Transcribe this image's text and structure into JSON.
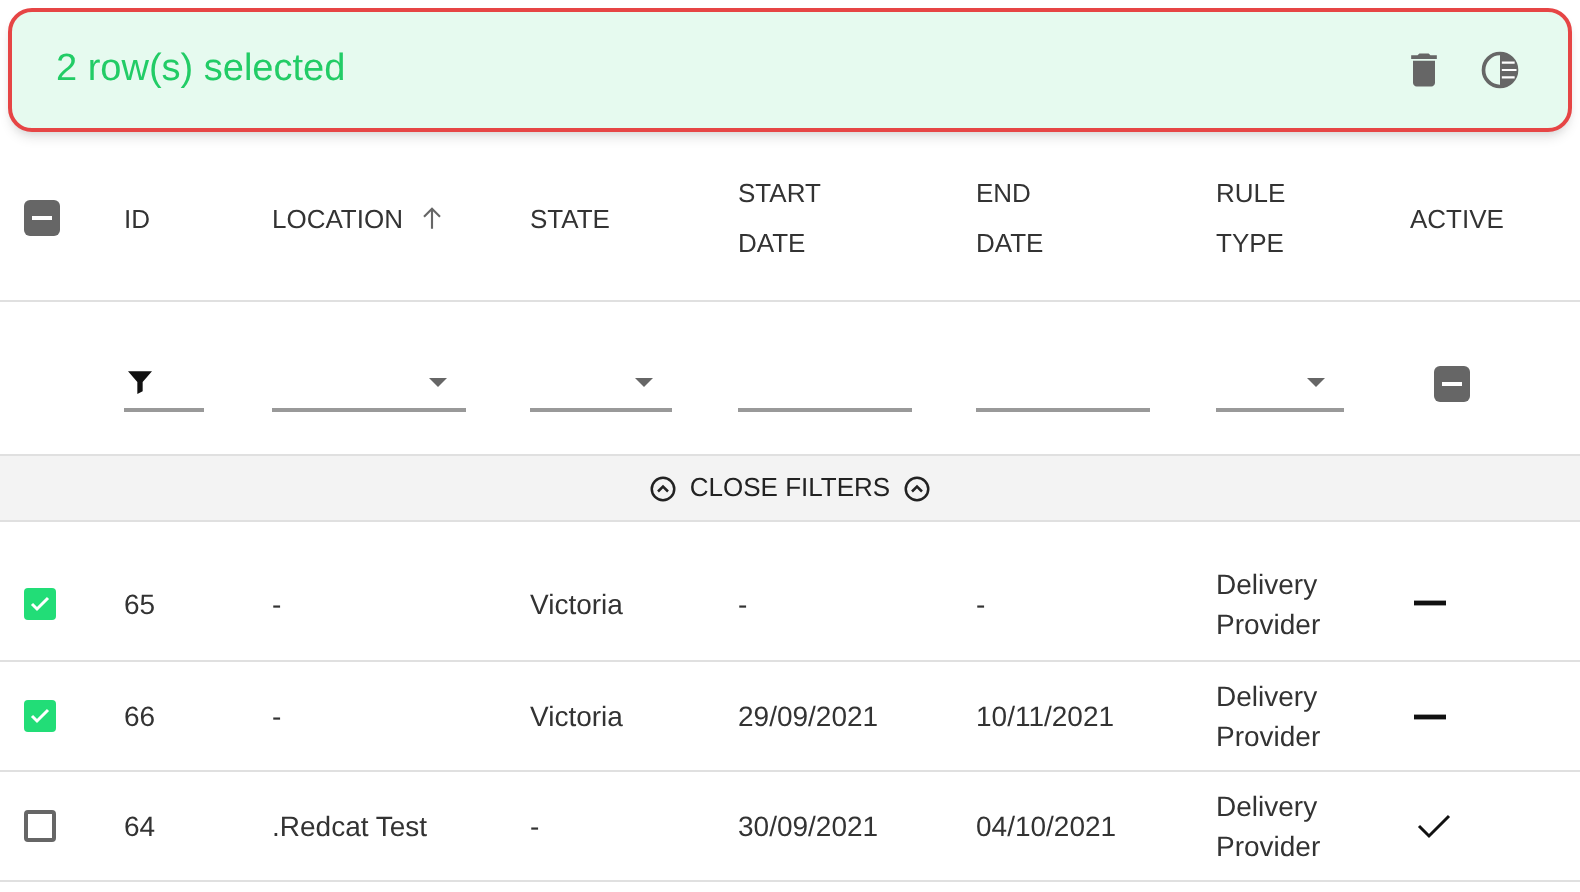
{
  "selection_bar": {
    "text": "2 row(s) selected"
  },
  "header": {
    "select_all_indeterminate": true,
    "columns": [
      {
        "label": "ID",
        "sorted_ascending": false
      },
      {
        "label": "LOCATION",
        "sorted_ascending": true
      },
      {
        "label": "STATE",
        "sorted_ascending": false
      },
      {
        "label": "START DATE",
        "sorted_ascending": false
      },
      {
        "label": "END DATE",
        "sorted_ascending": false
      },
      {
        "label": "RULE TYPE",
        "sorted_ascending": false
      },
      {
        "label": "ACTIVE",
        "sorted_ascending": false
      }
    ]
  },
  "filters": [
    {
      "kind": "funnel"
    },
    {
      "kind": "select"
    },
    {
      "kind": "select"
    },
    {
      "kind": "text"
    },
    {
      "kind": "text"
    },
    {
      "kind": "select"
    },
    {
      "kind": "tristate",
      "indeterminate": true
    }
  ],
  "close_filters": {
    "label": "CLOSE FILTERS"
  },
  "rows": [
    {
      "selected": true,
      "cells": [
        "65",
        "-",
        "Victoria",
        "-",
        "-",
        "Delivery Provider"
      ],
      "active": false
    },
    {
      "selected": true,
      "cells": [
        "66",
        "-",
        "Victoria",
        "29/09/2021",
        "10/11/2021",
        "Delivery Provider"
      ],
      "active": false
    },
    {
      "selected": false,
      "cells": [
        "64",
        ".Redcat Test",
        "-",
        "30/09/2021",
        "04/10/2021",
        "Delivery Provider"
      ],
      "active": true
    }
  ]
}
